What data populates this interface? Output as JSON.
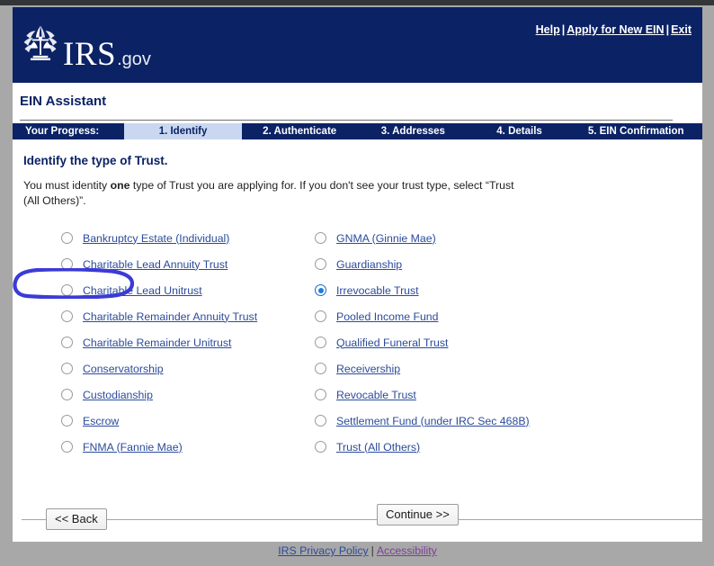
{
  "brand": {
    "logo_irs": "IRS",
    "logo_gov": ".gov",
    "logo_icon": "irs-eagle-scales-emblem"
  },
  "util_nav": {
    "help": "Help",
    "apply": "Apply for New EIN",
    "exit": "Exit",
    "separator": "|"
  },
  "app": {
    "title": "EIN Assistant"
  },
  "progress": {
    "label": "Your Progress:",
    "steps": [
      {
        "label": "1. Identify",
        "active": true
      },
      {
        "label": "2. Authenticate",
        "active": false
      },
      {
        "label": "3. Addresses",
        "active": false
      },
      {
        "label": "4. Details",
        "active": false
      },
      {
        "label": "5. EIN Confirmation",
        "active": false
      }
    ]
  },
  "question": {
    "heading": "Identify the type of Trust.",
    "description_part1": "You must identity ",
    "description_emphasis": "one",
    "description_part2": " type of Trust you are applying for. If you don't see your trust type, select “Trust (All Others)”."
  },
  "options": {
    "left_column": [
      {
        "label": "Bankruptcy Estate (Individual)",
        "selected": false
      },
      {
        "label": "Charitable Lead Annuity Trust",
        "selected": false
      },
      {
        "label": "Charitable Lead Unitrust",
        "selected": false
      },
      {
        "label": "Charitable Remainder Annuity Trust",
        "selected": false
      },
      {
        "label": "Charitable Remainder Unitrust",
        "selected": false
      },
      {
        "label": "Conservatorship",
        "selected": false
      },
      {
        "label": "Custodianship",
        "selected": false
      },
      {
        "label": "Escrow",
        "selected": false
      },
      {
        "label": "FNMA (Fannie Mae)",
        "selected": false
      }
    ],
    "right_column": [
      {
        "label": "GNMA (Ginnie Mae)",
        "selected": false
      },
      {
        "label": "Guardianship",
        "selected": false
      },
      {
        "label": "Irrevocable Trust",
        "selected": true
      },
      {
        "label": "Pooled Income Fund",
        "selected": false
      },
      {
        "label": "Qualified Funeral Trust",
        "selected": false
      },
      {
        "label": "Receivership",
        "selected": false
      },
      {
        "label": "Revocable Trust",
        "selected": false
      },
      {
        "label": "Settlement Fund (under IRC Sec 468B)",
        "selected": false
      },
      {
        "label": "Trust (All Others)",
        "selected": false
      }
    ]
  },
  "annotation": {
    "type": "hand-drawn-ellipse",
    "target": "Irrevocable Trust",
    "color": "#3b3bd6"
  },
  "buttons": {
    "back": "<< Back",
    "continue": "Continue >>"
  },
  "footer": {
    "privacy": "IRS Privacy Policy",
    "accessibility": "Accessibility",
    "separator": "|"
  },
  "colors": {
    "header_navy": "#0b2265",
    "active_step_bg": "#c9d8f0",
    "link_blue": "#2b4b9b",
    "visited_purple": "#7b3f98",
    "page_backdrop": "#a8a8a8"
  }
}
